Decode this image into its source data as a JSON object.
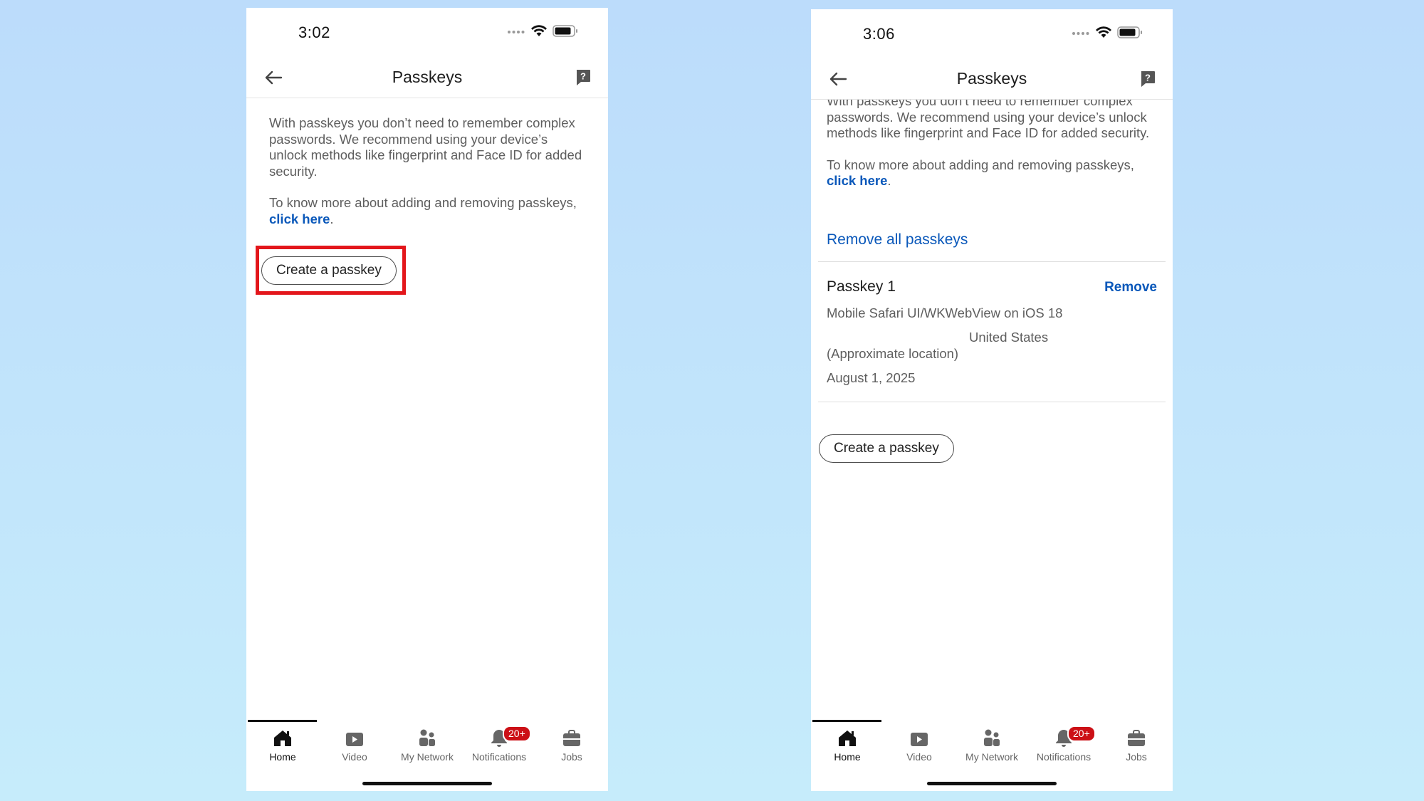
{
  "phone1": {
    "status": {
      "time": "3:02"
    },
    "header": {
      "title": "Passkeys"
    },
    "intro": "With passkeys you don’t need to remember complex passwords. We recommend using your device’s unlock methods like fingerprint and Face ID for added security.",
    "learn_more_prefix": "To know more about adding and removing passkeys,",
    "learn_more_link": "click here",
    "period": ".",
    "create_button": "Create a passkey"
  },
  "phone2": {
    "status": {
      "time": "3:06"
    },
    "header": {
      "title": "Passkeys"
    },
    "intro": "With passkeys you don’t need to remember complex passwords. We recommend using your device’s unlock methods like fingerprint and Face ID for added security.",
    "learn_more_prefix": "To know more about adding and removing passkeys,",
    "learn_more_link": "click here",
    "period": ".",
    "remove_all": "Remove all passkeys",
    "passkey": {
      "name": "Passkey 1",
      "remove": "Remove",
      "device": "Mobile Safari UI/WKWebView on iOS 18",
      "location": "United States",
      "location_note": "(Approximate location)",
      "date": "August 1, 2025"
    },
    "create_button": "Create a passkey"
  },
  "tabs": [
    {
      "label": "Home",
      "icon": "home-icon",
      "active": true
    },
    {
      "label": "Video",
      "icon": "video-icon"
    },
    {
      "label": "My Network",
      "icon": "network-icon"
    },
    {
      "label": "Notifications",
      "icon": "bell-icon",
      "badge": "20+"
    },
    {
      "label": "Jobs",
      "icon": "briefcase-icon"
    }
  ],
  "colors": {
    "link": "#0a58ba",
    "highlight": "#e3161b",
    "badge": "#cc1016"
  }
}
